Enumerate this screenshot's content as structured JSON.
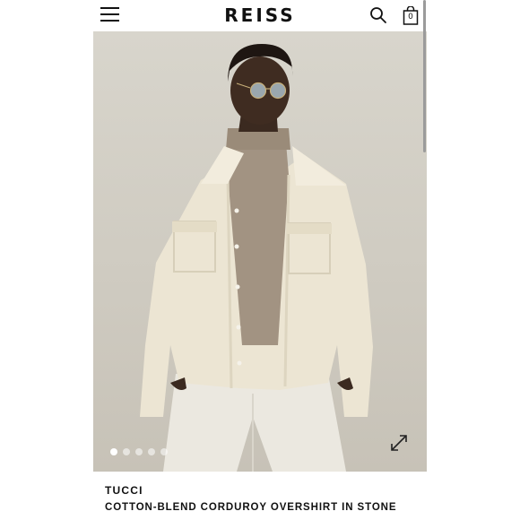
{
  "header": {
    "logo": "REISS",
    "icons": {
      "menu": "hamburger-menu-icon",
      "search": "search-icon",
      "bag": "shopping-bag-icon"
    },
    "bag_count": "0"
  },
  "gallery": {
    "image_description": "Model wearing a stone cotton-blend corduroy overshirt over a taupe roll-neck with white trousers and sunglasses",
    "total_images": 5,
    "active_index": 0,
    "expand_icon": "expand-arrows-icon"
  },
  "product": {
    "brand": "TUCCI",
    "title": "COTTON-BLEND CORDUROY OVERSHIRT IN STONE"
  },
  "colors": {
    "background": "#cfcbc1",
    "jacket": "#ece5d3",
    "text": "#111111"
  }
}
